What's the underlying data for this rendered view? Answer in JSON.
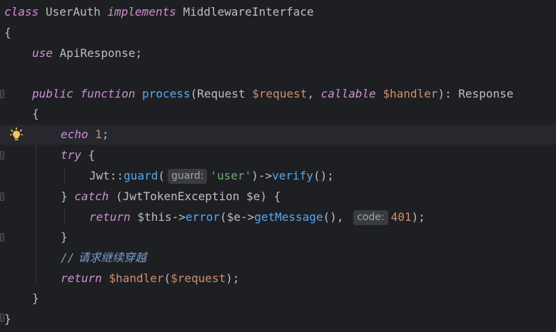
{
  "editor": {
    "lines": [
      {
        "id": "l1"
      },
      {
        "id": "l2"
      }
    ]
  },
  "code": {
    "l1_kw_class": "class",
    "l1_name": "UserAuth",
    "l1_kw_implements": "implements",
    "l1_iface": "MiddlewareInterface",
    "l2_brace": "{",
    "l3_kw_use": "use",
    "l3_trait": "ApiResponse;",
    "l5_kw_public": "public",
    "l5_kw_function": "function",
    "l5_fn": "process",
    "l5_paren_open": "(",
    "l5_type1": "Request ",
    "l5_var1": "$request",
    "l5_comma": ", ",
    "l5_kw_callable": "callable",
    "l5_var2": "$handler",
    "l5_paren_close": "): ",
    "l5_ret": "Response",
    "l6_brace": "{",
    "l7_kw_echo": "echo",
    "l7_num": "1",
    "l7_semi": ";",
    "l8_kw_try": "try",
    "l8_brace": " {",
    "l9_cls": "Jwt",
    "l9_op": "::",
    "l9_fn": "guard",
    "l9_paren": "(",
    "l9_hint": "guard:",
    "l9_str": "'user'",
    "l9_arrow": ")->",
    "l9_fn2": "verify",
    "l9_end": "();",
    "l10_brace": "} ",
    "l10_kw_catch": "catch",
    "l10_rest": " (JwtTokenException $e) {",
    "l11_kw_return": "return",
    "l11_this": "$this",
    "l11_arrow": "->",
    "l11_fn": "error",
    "l11_paren": "(",
    "l11_evar": "$e",
    "l11_arrow2": "->",
    "l11_fn2": "getMessage",
    "l11_mid": "(), ",
    "l11_hint": "code:",
    "l11_num": "401",
    "l11_end": ");",
    "l12_brace": "}",
    "l13_comment_slash": "//",
    "l13_comment_text": " 请求继续穿越",
    "l14_kw_return": "return",
    "l14_var": "$handler",
    "l14_paren": "(",
    "l14_var2": "$request",
    "l14_end": ");",
    "l15_brace": "}",
    "l16_brace": "}"
  },
  "icons": {
    "intention_bulb": "lightbulb-icon"
  },
  "colors": {
    "background": "#1e1f22",
    "current_line": "#26282e",
    "keyword": "#cf8ed6",
    "function": "#56a8f5",
    "variable": "#c77dbb",
    "number": "#2aacb8",
    "string": "#6aab73",
    "comment": "#7a9dc9",
    "bulb": "#f2c55c"
  }
}
